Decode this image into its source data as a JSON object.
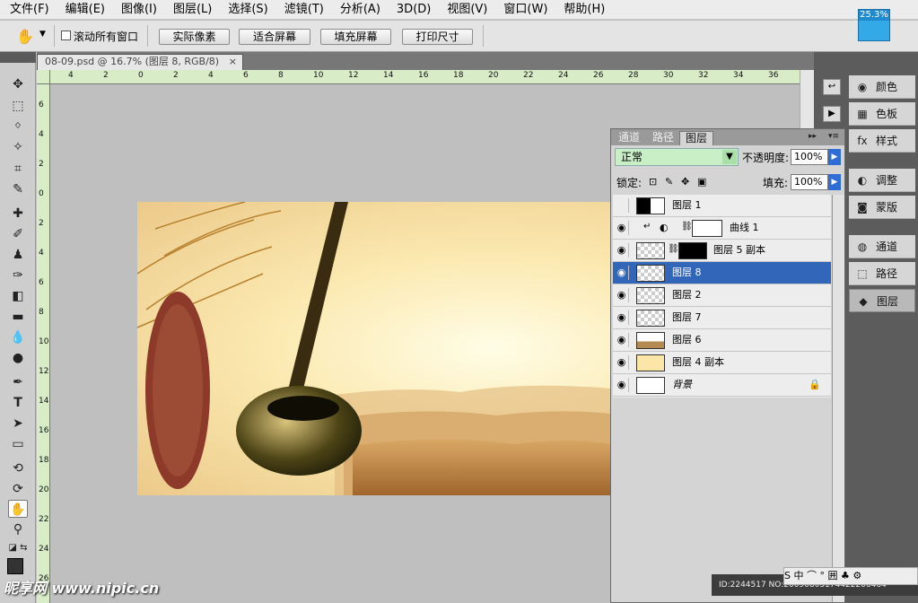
{
  "menu": [
    "文件(F)",
    "编辑(E)",
    "图像(I)",
    "图层(L)",
    "选择(S)",
    "滤镜(T)",
    "分析(A)",
    "3D(D)",
    "视图(V)",
    "窗口(W)",
    "帮助(H)"
  ],
  "zoom_indicator": "25.3%",
  "options": {
    "scroll_all_label": "滚动所有窗口",
    "buttons": [
      "实际像素",
      "适合屏幕",
      "填充屏幕",
      "打印尺寸"
    ]
  },
  "document": {
    "tab_title": "08-09.psd @ 16.7% (图层 8, RGB/8)",
    "close": "×"
  },
  "ruler": {
    "h_ticks": [
      "4",
      "2",
      "0",
      "2",
      "4",
      "6",
      "8",
      "10",
      "12",
      "14",
      "16",
      "18",
      "20",
      "22",
      "24",
      "26",
      "28",
      "30",
      "32",
      "34",
      "36"
    ],
    "v_ticks": [
      "6",
      "4",
      "2",
      "0",
      "2",
      "4",
      "6",
      "8",
      "10",
      "12",
      "14",
      "16",
      "18",
      "20",
      "22",
      "24",
      "26"
    ]
  },
  "dock": {
    "buttons": [
      {
        "label": "颜色",
        "icon": "palette-icon"
      },
      {
        "label": "色板",
        "icon": "swatches-icon"
      },
      {
        "label": "样式",
        "icon": "styles-icon"
      },
      {
        "label": "调整",
        "icon": "adjustments-icon"
      },
      {
        "label": "蒙版",
        "icon": "masks-icon"
      },
      {
        "label": "通道",
        "icon": "channels-icon"
      },
      {
        "label": "路径",
        "icon": "paths-icon"
      },
      {
        "label": "图层",
        "icon": "layers-icon"
      }
    ]
  },
  "layers_panel": {
    "tabs": [
      "通道",
      "路径",
      "图层"
    ],
    "active_tab": "图层",
    "blend_mode": "正常",
    "opacity_label": "不透明度:",
    "opacity": "100%",
    "lock_label": "锁定:",
    "fill_label": "填充:",
    "fill": "100%",
    "layers": [
      {
        "name": "图层 1",
        "visible": false,
        "selected": false
      },
      {
        "name": "曲线 1",
        "visible": true,
        "selected": false
      },
      {
        "name": "图层 5 副本",
        "visible": true,
        "selected": false
      },
      {
        "name": "图层 8",
        "visible": true,
        "selected": true
      },
      {
        "name": "图层 2",
        "visible": true,
        "selected": false
      },
      {
        "name": "图层 7",
        "visible": true,
        "selected": false
      },
      {
        "name": "图层 6",
        "visible": true,
        "selected": false
      },
      {
        "name": "图层 4 副本",
        "visible": true,
        "selected": false
      },
      {
        "name": "背景",
        "visible": true,
        "selected": false
      }
    ]
  },
  "status": "ID:2244517 NO:20090803174422206464",
  "ime": "S 中 ⌒ ° 囲 ♣ ⚙",
  "watermark": "昵享网 www.nipic.cn",
  "colors": {
    "accent": "#3266b8",
    "ruler": "#d8ecc8",
    "blend_bg": "#c9efc7",
    "zoom": "#34a9e8"
  }
}
